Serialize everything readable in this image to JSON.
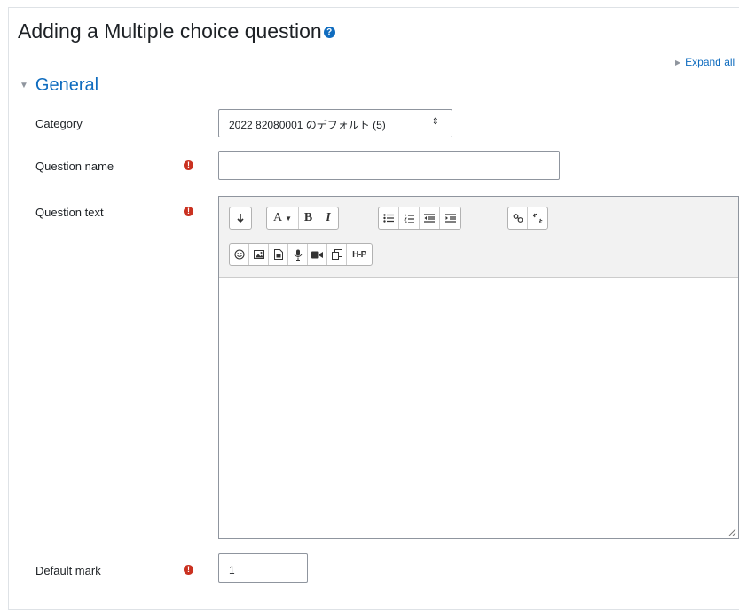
{
  "page": {
    "title": "Adding a Multiple choice question",
    "expand_all": "Expand all"
  },
  "section": {
    "title": "General"
  },
  "form": {
    "category_label": "Category",
    "category_value": "2022 82080001 のデフォルト (5)",
    "question_name_label": "Question name",
    "question_name_value": "",
    "question_text_label": "Question text",
    "default_mark_label": "Default mark",
    "default_mark_value": "1"
  },
  "editor": {
    "toolbar_row1": [
      "collapse",
      "font-style",
      "bold",
      "italic",
      "unordered-list",
      "ordered-list",
      "outdent",
      "indent",
      "link",
      "unlink"
    ],
    "toolbar_row2": [
      "emoji",
      "image",
      "media",
      "record-audio",
      "record-video",
      "manage-files",
      "h5p"
    ],
    "bold_glyph": "B",
    "italic_glyph": "I",
    "h5p_glyph": "H-P"
  },
  "colors": {
    "link": "#0f6cbf",
    "required": "#ca3120",
    "border": "#8f959e",
    "toolbar_bg": "#f2f2f2"
  }
}
